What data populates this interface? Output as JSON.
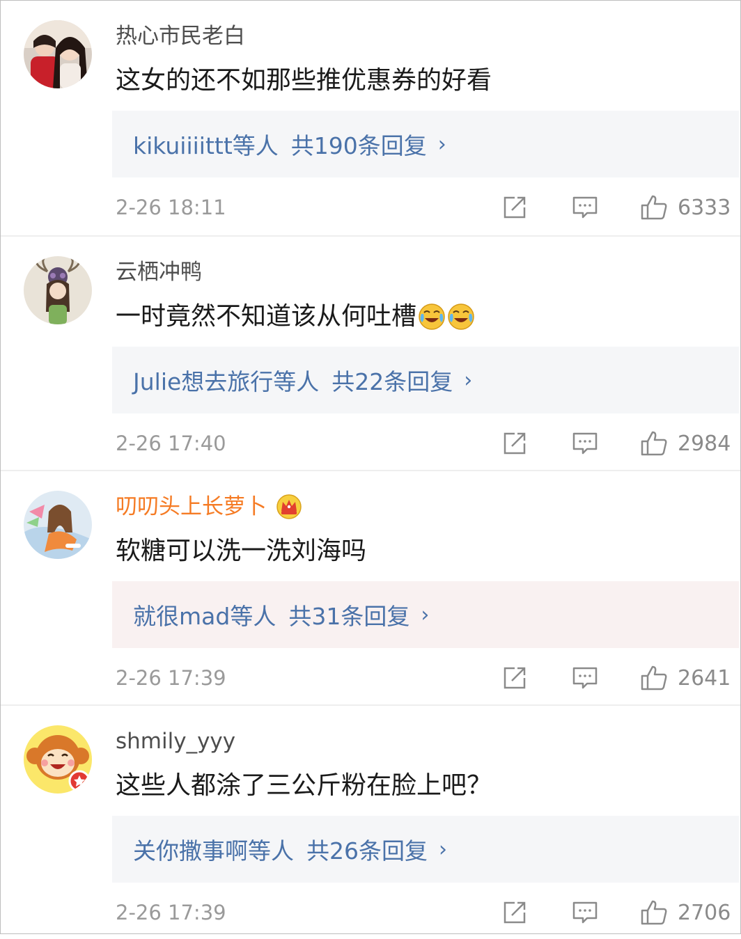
{
  "comments": [
    {
      "username": "热心市民老白",
      "text": "这女的还不如那些推优惠券的好看",
      "reply_users": "kikuiiiittt",
      "reply_users_suffix": "等人",
      "reply_total": "共190条回复",
      "chevron": "›",
      "time": "2-26 18:11",
      "likes": "6333",
      "avatar_icon": "photo-avatar-two-women"
    },
    {
      "username": "云栖冲鸭",
      "text": "一时竟然不知道该从何吐槽",
      "emoji": "laugh-cry-emoji",
      "reply_users": "Julie想去旅行",
      "reply_users_suffix": "等人",
      "reply_total": "共22条回复",
      "chevron": "›",
      "time": "2-26 17:40",
      "likes": "2984",
      "avatar_icon": "illustrated-girl-with-antlers-avatar"
    },
    {
      "username": "叨叨头上长萝卜",
      "text": "软糖可以洗一洗刘海吗",
      "reply_users": "就很mad",
      "reply_users_suffix": "等人",
      "reply_total": "共31条回复",
      "chevron": "›",
      "time": "2-26 17:39",
      "likes": "2641",
      "avatar_icon": "illustrated-girl-avatar",
      "badge_icon": "crown-icon"
    },
    {
      "username": "shmily_yyy",
      "text": "这些人都涂了三公斤粉在脸上吧？",
      "reply_users": "关你撒事啊",
      "reply_users_suffix": "等人",
      "reply_total": "共26条回复",
      "chevron": "›",
      "time": "2-26 17:39",
      "likes": "2706",
      "avatar_icon": "cartoon-monkey-avatar"
    }
  ],
  "colors": {
    "link": "#4a72a9",
    "vip_name": "#f57b24",
    "username": "#4d4d4d",
    "meta": "#9a9a9a",
    "reply_bg": "#f5f6f8"
  }
}
